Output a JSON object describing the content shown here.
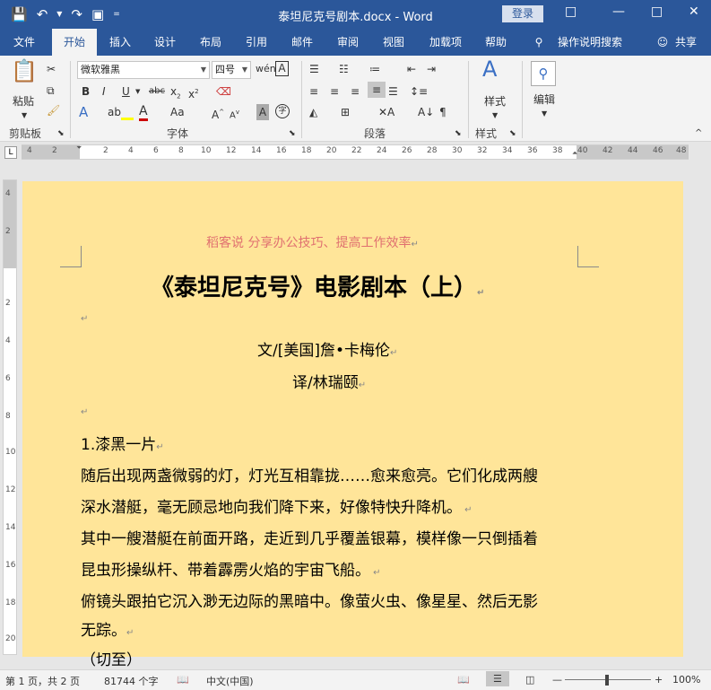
{
  "titlebar": {
    "title": "泰坦尼克号剧本.docx - Word",
    "login": "登录"
  },
  "tabs": [
    "文件",
    "开始",
    "插入",
    "设计",
    "布局",
    "引用",
    "邮件",
    "审阅",
    "视图",
    "加载项",
    "帮助"
  ],
  "search_hint": "操作说明搜索",
  "share": "共享",
  "ribbon": {
    "paste": "粘贴",
    "font_name": "微软雅黑",
    "font_size": "四号",
    "styles": "样式",
    "edit": "编辑",
    "groups": [
      "剪贴板",
      "字体",
      "段落",
      "样式"
    ]
  },
  "ruler_h": [
    "4",
    "2",
    "2",
    "4",
    "6",
    "8",
    "10",
    "12",
    "14",
    "16",
    "18",
    "20",
    "22",
    "24",
    "26",
    "28",
    "30",
    "32",
    "34",
    "36",
    "38",
    "40",
    "42",
    "44",
    "46",
    "48"
  ],
  "ruler_v": [
    "4",
    "2",
    "2",
    "4",
    "6",
    "8",
    "10",
    "12",
    "14",
    "16",
    "18",
    "20"
  ],
  "document": {
    "header": "稻客说    分享办公技巧、提高工作效率",
    "title": "《泰坦尼克号》电影剧本（上）",
    "author": "文/[美国]詹•卡梅伦",
    "translator": "译/林瑞颐",
    "scene": "1.漆黑一片",
    "p1a": "随后出现两盏微弱的灯，灯光互相靠拢……愈来愈亮。它们化成两艘",
    "p1b": "深水潜艇，毫无顾忌地向我们降下来，好像特快升降机。",
    "p2a": "其中一艘潜艇在前面开路，走近到几乎覆盖银幕，模样像一只倒插着",
    "p2b": "昆虫形操纵杆、带着霹雳火焰的宇宙飞船。",
    "p3a": "俯镜头跟拍它沉入渺无边际的黑暗中。像萤火虫、像星星、然后无影",
    "p3b": "无踪。",
    "p4": "（切至）"
  },
  "status": {
    "page": "第 1 页，共 2 页",
    "words": "81744 个字",
    "lang": "中文(中国)",
    "zoom": "100%"
  }
}
